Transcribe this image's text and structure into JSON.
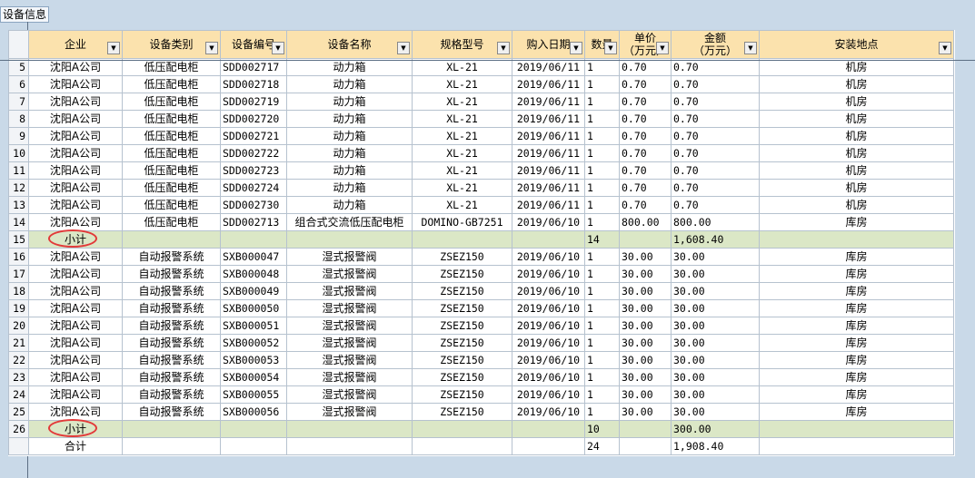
{
  "window": {
    "tab_title": "设备信息"
  },
  "table": {
    "columns": [
      "企业",
      "设备类别",
      "设备编号",
      "设备名称",
      "规格型号",
      "购入日期",
      "数量",
      "单价\n（万元）",
      "金额\n（万元）",
      "安装地点"
    ],
    "rows": [
      {
        "n": "5",
        "company": "沈阳A公司",
        "category": "低压配电柜",
        "code": "SDD002717",
        "name": "动力箱",
        "spec": "XL-21",
        "date": "2019/06/11",
        "qty": "1",
        "price": "0.70",
        "amount": "0.70",
        "location": "机房"
      },
      {
        "n": "6",
        "company": "沈阳A公司",
        "category": "低压配电柜",
        "code": "SDD002718",
        "name": "动力箱",
        "spec": "XL-21",
        "date": "2019/06/11",
        "qty": "1",
        "price": "0.70",
        "amount": "0.70",
        "location": "机房"
      },
      {
        "n": "7",
        "company": "沈阳A公司",
        "category": "低压配电柜",
        "code": "SDD002719",
        "name": "动力箱",
        "spec": "XL-21",
        "date": "2019/06/11",
        "qty": "1",
        "price": "0.70",
        "amount": "0.70",
        "location": "机房"
      },
      {
        "n": "8",
        "company": "沈阳A公司",
        "category": "低压配电柜",
        "code": "SDD002720",
        "name": "动力箱",
        "spec": "XL-21",
        "date": "2019/06/11",
        "qty": "1",
        "price": "0.70",
        "amount": "0.70",
        "location": "机房"
      },
      {
        "n": "9",
        "company": "沈阳A公司",
        "category": "低压配电柜",
        "code": "SDD002721",
        "name": "动力箱",
        "spec": "XL-21",
        "date": "2019/06/11",
        "qty": "1",
        "price": "0.70",
        "amount": "0.70",
        "location": "机房"
      },
      {
        "n": "10",
        "company": "沈阳A公司",
        "category": "低压配电柜",
        "code": "SDD002722",
        "name": "动力箱",
        "spec": "XL-21",
        "date": "2019/06/11",
        "qty": "1",
        "price": "0.70",
        "amount": "0.70",
        "location": "机房"
      },
      {
        "n": "11",
        "company": "沈阳A公司",
        "category": "低压配电柜",
        "code": "SDD002723",
        "name": "动力箱",
        "spec": "XL-21",
        "date": "2019/06/11",
        "qty": "1",
        "price": "0.70",
        "amount": "0.70",
        "location": "机房"
      },
      {
        "n": "12",
        "company": "沈阳A公司",
        "category": "低压配电柜",
        "code": "SDD002724",
        "name": "动力箱",
        "spec": "XL-21",
        "date": "2019/06/11",
        "qty": "1",
        "price": "0.70",
        "amount": "0.70",
        "location": "机房"
      },
      {
        "n": "13",
        "company": "沈阳A公司",
        "category": "低压配电柜",
        "code": "SDD002730",
        "name": "动力箱",
        "spec": "XL-21",
        "date": "2019/06/11",
        "qty": "1",
        "price": "0.70",
        "amount": "0.70",
        "location": "机房"
      },
      {
        "n": "14",
        "company": "沈阳A公司",
        "category": "低压配电柜",
        "code": "SDD002713",
        "name": "组合式交流低压配电柜",
        "spec": "DOMINO-GB7251",
        "date": "2019/06/10",
        "qty": "1",
        "price": "800.00",
        "amount": "800.00",
        "location": "库房"
      },
      {
        "n": "15",
        "subtotal": true,
        "company": "小计",
        "qty": "14",
        "amount": "1,608.40"
      },
      {
        "n": "16",
        "company": "沈阳A公司",
        "category": "自动报警系统",
        "code": "SXB000047",
        "name": "湿式报警阀",
        "spec": "ZSEZ150",
        "date": "2019/06/10",
        "qty": "1",
        "price": "30.00",
        "amount": "30.00",
        "location": "库房"
      },
      {
        "n": "17",
        "company": "沈阳A公司",
        "category": "自动报警系统",
        "code": "SXB000048",
        "name": "湿式报警阀",
        "spec": "ZSEZ150",
        "date": "2019/06/10",
        "qty": "1",
        "price": "30.00",
        "amount": "30.00",
        "location": "库房"
      },
      {
        "n": "18",
        "company": "沈阳A公司",
        "category": "自动报警系统",
        "code": "SXB000049",
        "name": "湿式报警阀",
        "spec": "ZSEZ150",
        "date": "2019/06/10",
        "qty": "1",
        "price": "30.00",
        "amount": "30.00",
        "location": "库房"
      },
      {
        "n": "19",
        "company": "沈阳A公司",
        "category": "自动报警系统",
        "code": "SXB000050",
        "name": "湿式报警阀",
        "spec": "ZSEZ150",
        "date": "2019/06/10",
        "qty": "1",
        "price": "30.00",
        "amount": "30.00",
        "location": "库房"
      },
      {
        "n": "20",
        "company": "沈阳A公司",
        "category": "自动报警系统",
        "code": "SXB000051",
        "name": "湿式报警阀",
        "spec": "ZSEZ150",
        "date": "2019/06/10",
        "qty": "1",
        "price": "30.00",
        "amount": "30.00",
        "location": "库房"
      },
      {
        "n": "21",
        "company": "沈阳A公司",
        "category": "自动报警系统",
        "code": "SXB000052",
        "name": "湿式报警阀",
        "spec": "ZSEZ150",
        "date": "2019/06/10",
        "qty": "1",
        "price": "30.00",
        "amount": "30.00",
        "location": "库房"
      },
      {
        "n": "22",
        "company": "沈阳A公司",
        "category": "自动报警系统",
        "code": "SXB000053",
        "name": "湿式报警阀",
        "spec": "ZSEZ150",
        "date": "2019/06/10",
        "qty": "1",
        "price": "30.00",
        "amount": "30.00",
        "location": "库房"
      },
      {
        "n": "23",
        "company": "沈阳A公司",
        "category": "自动报警系统",
        "code": "SXB000054",
        "name": "湿式报警阀",
        "spec": "ZSEZ150",
        "date": "2019/06/10",
        "qty": "1",
        "price": "30.00",
        "amount": "30.00",
        "location": "库房"
      },
      {
        "n": "24",
        "company": "沈阳A公司",
        "category": "自动报警系统",
        "code": "SXB000055",
        "name": "湿式报警阀",
        "spec": "ZSEZ150",
        "date": "2019/06/10",
        "qty": "1",
        "price": "30.00",
        "amount": "30.00",
        "location": "库房"
      },
      {
        "n": "25",
        "company": "沈阳A公司",
        "category": "自动报警系统",
        "code": "SXB000056",
        "name": "湿式报警阀",
        "spec": "ZSEZ150",
        "date": "2019/06/10",
        "qty": "1",
        "price": "30.00",
        "amount": "30.00",
        "location": "库房"
      },
      {
        "n": "26",
        "subtotal": true,
        "company": "小计",
        "qty": "10",
        "amount": "300.00"
      },
      {
        "n": "",
        "total": true,
        "company": "合计",
        "qty": "24",
        "amount": "1,908.40"
      }
    ]
  },
  "colors": {
    "header_bg": "#fbe2ad",
    "subtotal_bg": "#dbe7c6",
    "highlight_oval": "#e23a3a"
  }
}
